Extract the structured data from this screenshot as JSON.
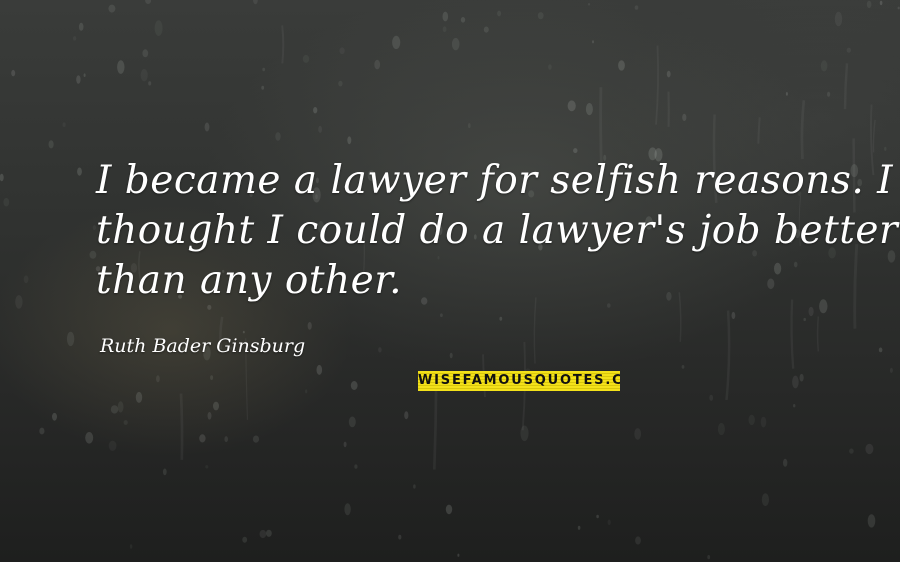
{
  "quote": {
    "lines": [
      "I became a lawyer for selfish reasons. I",
      "thought I could do a lawyer's job better",
      "than any other."
    ]
  },
  "author": "Ruth Bader Ginsburg",
  "watermark": {
    "text": "WISEFAMOUSQUOTES.COM",
    "colors": {
      "background": "#f3e11a",
      "text": "#111111"
    }
  },
  "colors": {
    "background_dark": "#1e1f1e",
    "background_mid": "#3a3c3a",
    "text": "#ffffff"
  }
}
